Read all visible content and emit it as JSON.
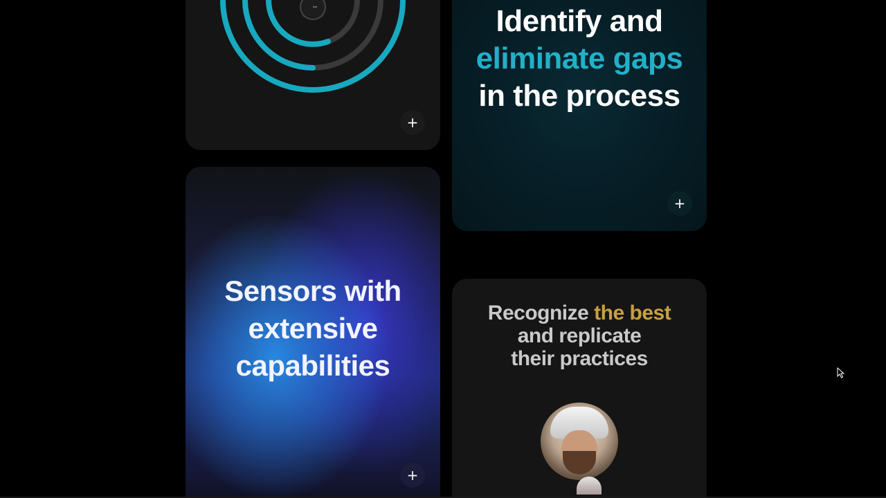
{
  "cards": {
    "rings": {
      "plus": "+"
    },
    "gaps": {
      "line1": "Identify and",
      "line2_accent": "eliminate gaps",
      "line3": "in the process",
      "plus": "+"
    },
    "sensors": {
      "line1": "Sensors with",
      "line2": "extensive",
      "line3": "capabilities",
      "plus": "+"
    },
    "recognize": {
      "line1_prefix": "Recognize",
      "line1_accent": "the best",
      "line2": "and replicate",
      "line3": "their practices"
    }
  },
  "colors": {
    "teal_accent": "#22b0c8",
    "gold_accent": "#c9a040",
    "ring_teal": "#17a9bf",
    "ring_gray": "#3a3a3a"
  },
  "icons": [
    "plus-icon",
    "watch-icon",
    "cursor-icon",
    "avatar"
  ]
}
